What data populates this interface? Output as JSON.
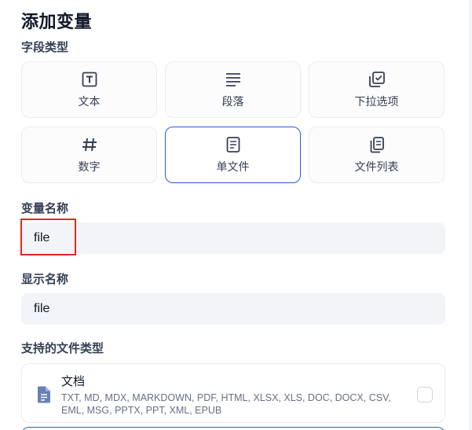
{
  "title": "添加变量",
  "field_type": {
    "label": "字段类型",
    "options": [
      {
        "label": "文本",
        "icon": "text-icon"
      },
      {
        "label": "段落",
        "icon": "paragraph-icon"
      },
      {
        "label": "下拉选项",
        "icon": "select-icon"
      },
      {
        "label": "数字",
        "icon": "hash-icon"
      },
      {
        "label": "单文件",
        "icon": "file-icon",
        "selected": true
      },
      {
        "label": "文件列表",
        "icon": "file-list-icon"
      }
    ]
  },
  "variable_name": {
    "label": "变量名称",
    "value": "file"
  },
  "display_name": {
    "label": "显示名称",
    "value": "file"
  },
  "file_types": {
    "label": "支持的文件类型",
    "items": [
      {
        "name": "文档",
        "extensions": "TXT, MD, MDX, MARKDOWN, PDF, HTML, XLSX, XLS, DOC, DOCX, CSV, EML, MSG, PPTX, PPT, XML, EPUB",
        "checked": false
      }
    ]
  },
  "colors": {
    "accent": "#2e5bd8",
    "highlight": "#d92d20",
    "input_bg": "#f2f4f7"
  }
}
